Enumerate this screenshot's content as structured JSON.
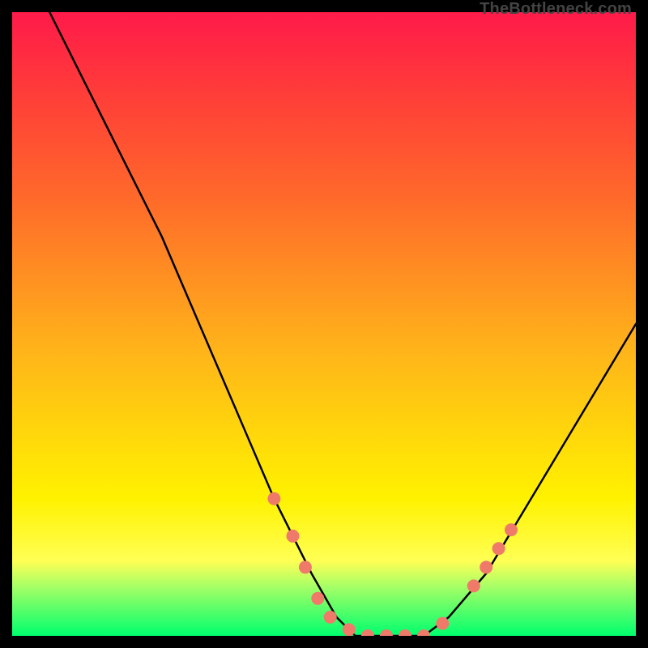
{
  "watermark": "TheBottleneck.com",
  "chart_data": {
    "type": "line",
    "title": "",
    "xlabel": "",
    "ylabel": "",
    "xlim": [
      0,
      100
    ],
    "ylim": [
      0,
      100
    ],
    "grid": false,
    "legend": false,
    "background_gradient_stops": [
      {
        "pos": 0,
        "color": "#ff1a4a"
      },
      {
        "pos": 12,
        "color": "#ff3a3a"
      },
      {
        "pos": 30,
        "color": "#ff6a2a"
      },
      {
        "pos": 55,
        "color": "#ffb619"
      },
      {
        "pos": 78,
        "color": "#fff200"
      },
      {
        "pos": 88,
        "color": "#ffff55"
      },
      {
        "pos": 92,
        "color": "#a8ff66"
      },
      {
        "pos": 100,
        "color": "#00ff6e"
      }
    ],
    "series": [
      {
        "name": "curve",
        "color": "#000000",
        "x": [
          6,
          12,
          18,
          24,
          30,
          36,
          42,
          48,
          52,
          55,
          58,
          62,
          66,
          70,
          76,
          82,
          88,
          94,
          100
        ],
        "y": [
          100,
          88,
          76,
          64,
          50,
          36,
          22,
          10,
          3,
          0,
          0,
          0,
          0,
          3,
          10,
          20,
          30,
          40,
          50
        ]
      }
    ],
    "markers": {
      "name": "red-dots",
      "color": "#ef7a6a",
      "radius_px": 8,
      "points": [
        {
          "x": 42,
          "y": 22
        },
        {
          "x": 45,
          "y": 16
        },
        {
          "x": 47,
          "y": 11
        },
        {
          "x": 49,
          "y": 6
        },
        {
          "x": 51,
          "y": 3
        },
        {
          "x": 54,
          "y": 1
        },
        {
          "x": 57,
          "y": 0
        },
        {
          "x": 60,
          "y": 0
        },
        {
          "x": 63,
          "y": 0
        },
        {
          "x": 66,
          "y": 0
        },
        {
          "x": 69,
          "y": 2
        },
        {
          "x": 74,
          "y": 8
        },
        {
          "x": 76,
          "y": 11
        },
        {
          "x": 78,
          "y": 14
        },
        {
          "x": 80,
          "y": 17
        }
      ]
    }
  }
}
